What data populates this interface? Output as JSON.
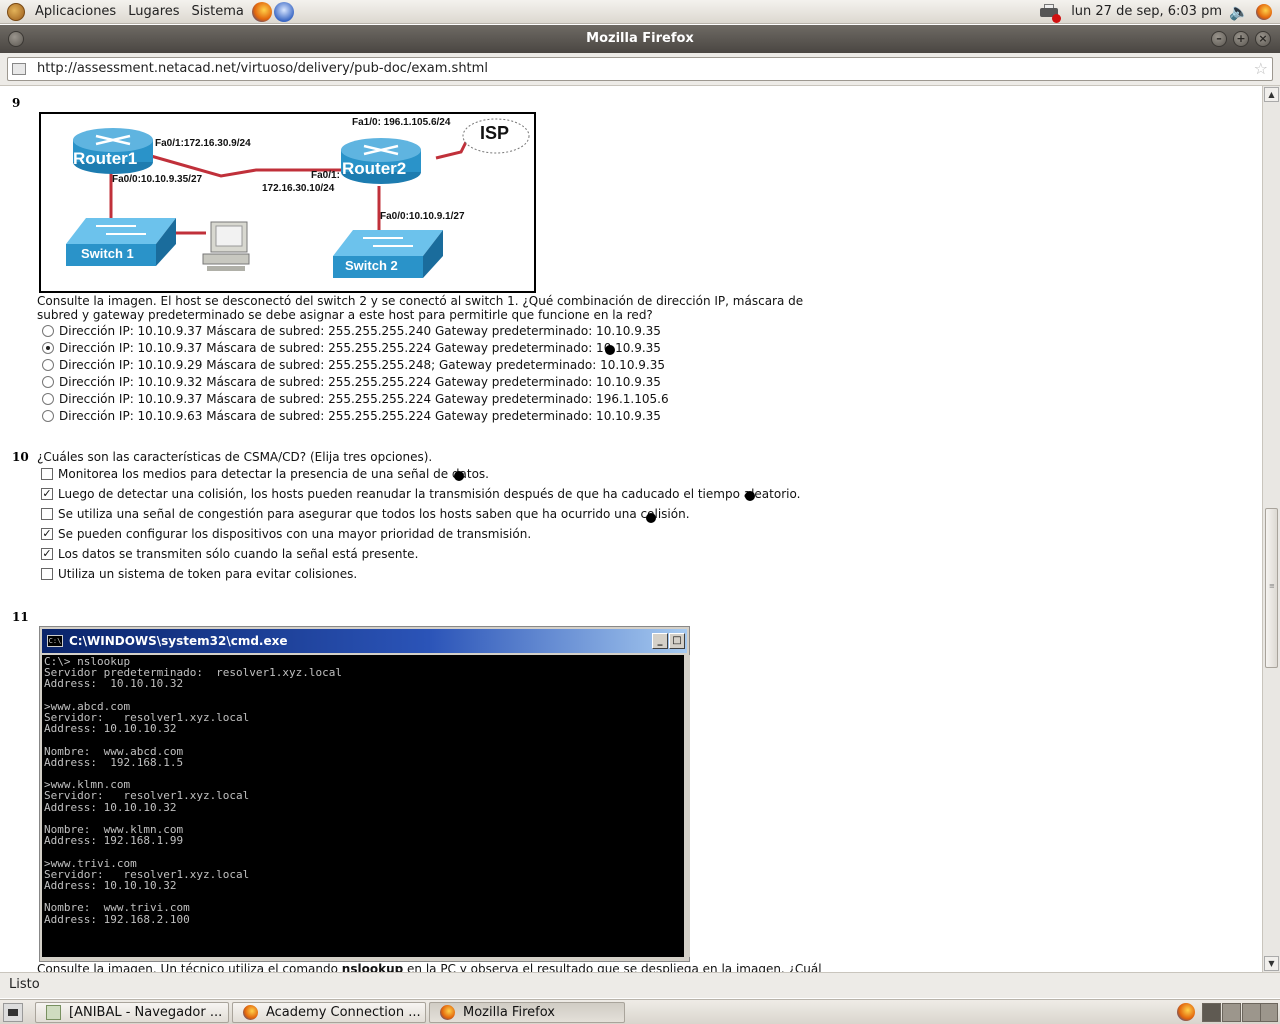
{
  "panel": {
    "menus": [
      "Aplicaciones",
      "Lugares",
      "Sistema"
    ],
    "clock": "lun 27 de sep,  6:03 pm"
  },
  "window": {
    "title": "Mozilla Firefox"
  },
  "urlbar": {
    "url": "http://assessment.netacad.net/virtuoso/delivery/pub-doc/exam.shtml"
  },
  "q9": {
    "number": "9",
    "diagram": {
      "router1": "Router1",
      "router2": "Router2",
      "isp": "ISP",
      "switch1": "Switch 1",
      "switch2": "Switch 2",
      "r1_fa01": "Fa0/1:172.16.30.9/24",
      "r1_fa00": "Fa0/0:10.10.9.35/27",
      "r2_fa01a": "Fa0/1:",
      "r2_fa01b": "172.16.30.10/24",
      "r2_fa10": "Fa1/0: 196.1.105.6/24",
      "r2_fa00": "Fa0/0:10.10.9.1/27"
    },
    "text_line1": "Consulte la imagen. El host se desconectó del switch 2 y se conectó al switch 1. ¿Qué combinación de dirección IP, máscara de",
    "text_line2": "subred y gateway predeterminado se debe asignar a este host para permitirle que funcione en la red?",
    "options": [
      "Dirección IP: 10.10.9.37 Máscara de subred: 255.255.255.240 Gateway predeterminado: 10.10.9.35",
      "Dirección IP: 10.10.9.37 Máscara de subred: 255.255.255.224 Gateway predeterminado: 10.10.9.35",
      "Dirección IP: 10.10.9.29 Máscara de subred: 255.255.255.248; Gateway predeterminado: 10.10.9.35",
      "Dirección IP: 10.10.9.32 Máscara de subred: 255.255.255.224 Gateway predeterminado: 10.10.9.35",
      "Dirección IP: 10.10.9.37 Máscara de subred: 255.255.255.224 Gateway predeterminado: 196.1.105.6",
      "Dirección IP: 10.10.9.63 Máscara de subred: 255.255.255.224 Gateway predeterminado: 10.10.9.35"
    ],
    "selected_index": 1
  },
  "q10": {
    "number": "10",
    "text": "¿Cuáles son las características de CSMA/CD? (Elija tres opciones).",
    "options": [
      "Monitorea los medios para detectar la presencia de una señal de datos.",
      "Luego de detectar una colisión, los hosts pueden reanudar la transmisión después de que ha caducado el tiempo aleatorio.",
      "Se utiliza una señal de congestión para asegurar que todos los hosts saben que ha ocurrido una colisión.",
      "Se pueden configurar los dispositivos con una mayor prioridad de transmisión.",
      "Los datos se transmiten sólo cuando la señal está presente.",
      "Utiliza un sistema de token para evitar colisiones."
    ],
    "checked": [
      false,
      true,
      false,
      true,
      true,
      false
    ]
  },
  "q11": {
    "number": "11",
    "cmd_title": "C:\\WINDOWS\\system32\\cmd.exe",
    "cmd_icon": "C:\\",
    "cmd_output": "C:\\> nslookup\nServidor predeterminado:  resolver1.xyz.local\nAddress:  10.10.10.32\n\n>www.abcd.com\nServidor:   resolver1.xyz.local\nAddress: 10.10.10.32\n\nNombre:  www.abcd.com\nAddress:  192.168.1.5\n\n>www.klmn.com\nServidor:   resolver1.xyz.local\nAddress: 10.10.10.32\n\nNombre:  www.klmn.com\nAddress: 192.168.1.99\n\n>www.trivi.com\nServidor:   resolver1.xyz.local\nAddress: 10.10.10.32\n\nNombre:  www.trivi.com\nAddress: 192.168.2.100",
    "text_before": "Consulte la imagen. Un técnico utiliza el comando ",
    "text_bold": "nslookup",
    "text_after": " en la PC y observa el resultado que se despliega en la imagen. ¿Cuál"
  },
  "statusbar": {
    "text": "Listo"
  },
  "taskbar": {
    "tasks": [
      "[ANIBAL - Navegador ...",
      "Academy Connection ...",
      "Mozilla Firefox"
    ]
  }
}
